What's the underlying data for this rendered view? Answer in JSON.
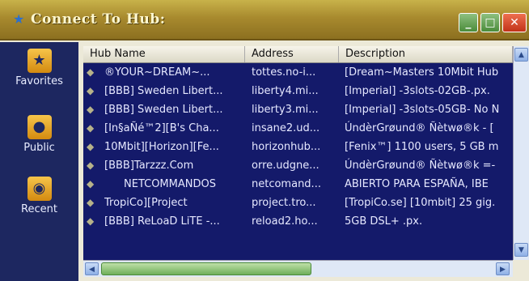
{
  "window": {
    "title": "Connect To Hub:",
    "icon": "hub-icon"
  },
  "titlebar_buttons": {
    "minimize": "_",
    "maximize": "□",
    "close": "✕"
  },
  "sidebar": {
    "items": [
      {
        "label": "Favorites",
        "icon": "favorites-icon"
      },
      {
        "label": "Public",
        "icon": "public-icon"
      },
      {
        "label": "Recent",
        "icon": "recent-icon"
      }
    ]
  },
  "table": {
    "columns": [
      "Hub Name",
      "Address",
      "Description"
    ],
    "rows": [
      {
        "name": "®YOUR~DREAM~...",
        "address": "tottes.no-i...",
        "description": "[Dream~Masters 10Mbit Hub"
      },
      {
        "name": "[BBB] Sweden Libert...",
        "address": "liberty4.mi...",
        "description": "[Imperial] -3slots-02GB-.px."
      },
      {
        "name": "[BBB] Sweden Libert...",
        "address": "liberty3.mi...",
        "description": "[Imperial] -3slots-05GB- No N"
      },
      {
        "name": "[In§aÑé™2][B's Cha...",
        "address": "insane2.ud...",
        "description": "ÚndèrGrøund® Ñètwø®k - ["
      },
      {
        "name": "10Mbit][Horizon][Fe...",
        "address": "horizonhub...",
        "description": "[Fenix™] 1100 users, 5 GB m"
      },
      {
        "name": "[BBB]Tarzzz.Com",
        "address": "orre.udgne...",
        "description": "ÚndèrGrøund® Ñètwø®k =-"
      },
      {
        "name": "NETCOMMANDOS",
        "address": "netcomand...",
        "description": "ABIERTO PARA ESPAÑA, IBE"
      },
      {
        "name": "TropiCo][Project",
        "address": "project.tro...",
        "description": "[TropiCo.se] [10mbit] 25 gig."
      },
      {
        "name": "[BBB] ReLoaD LiTE -...",
        "address": "reload2.ho...",
        "description": "5GB DSL+ .px."
      }
    ]
  }
}
